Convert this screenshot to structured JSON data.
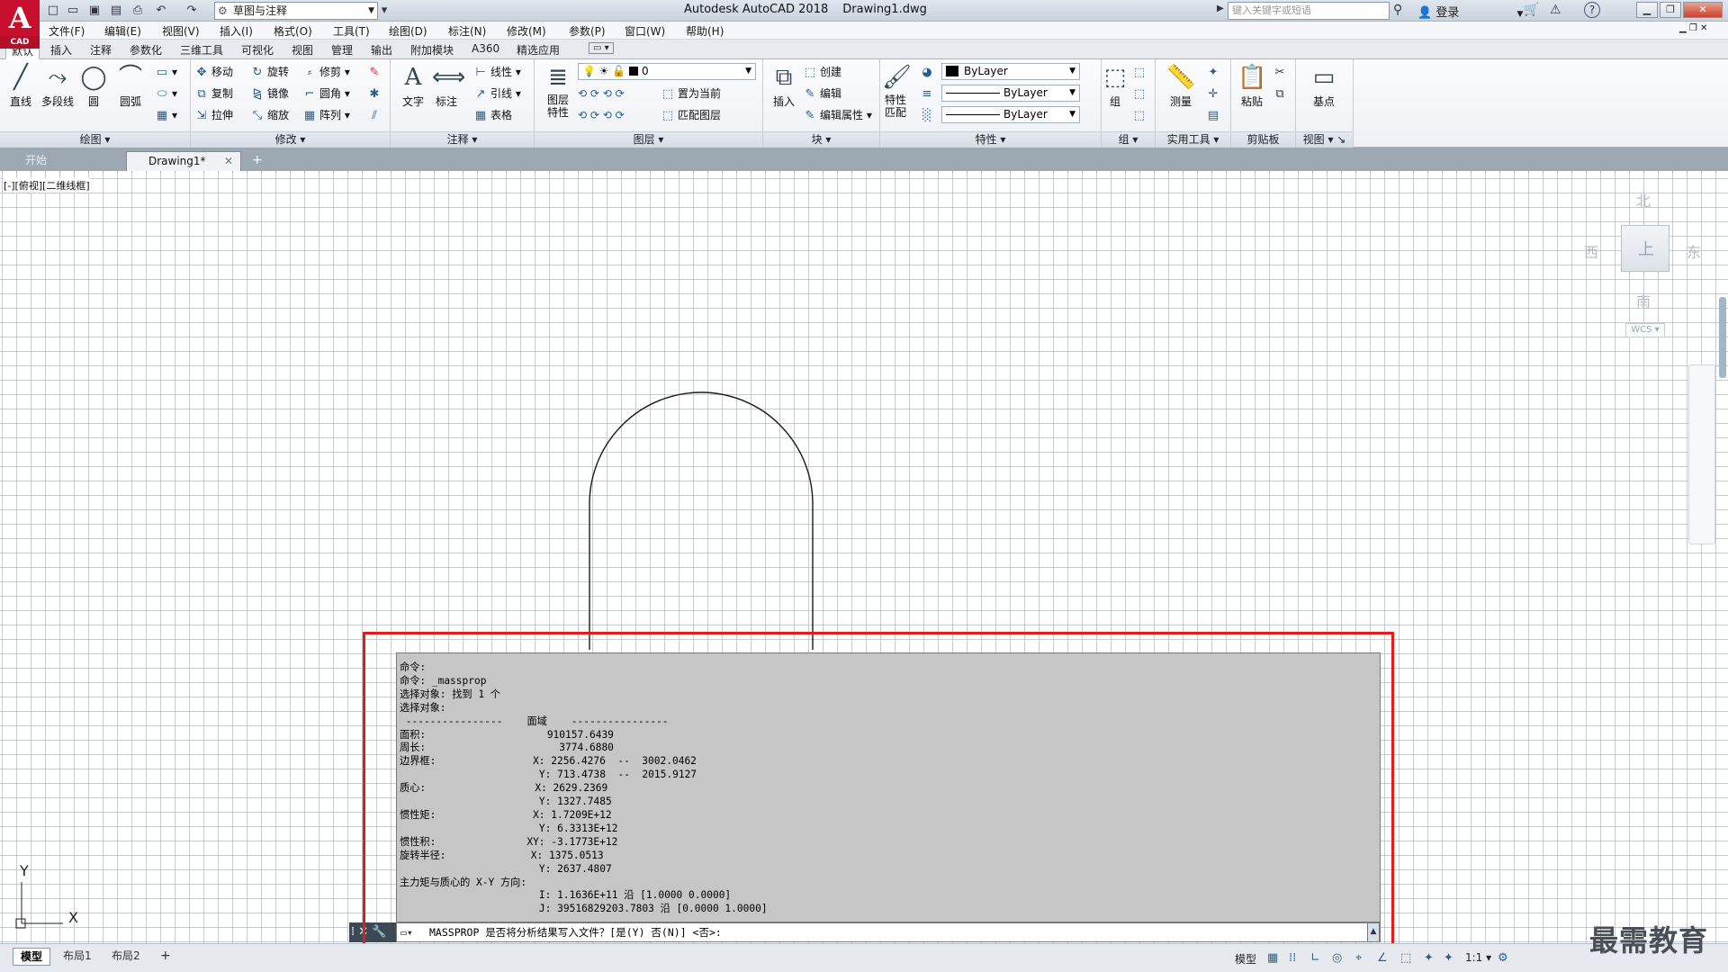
{
  "colors": {
    "accent": "#c8102e",
    "highlight": "#e01e1e",
    "canvas_grid": "#c7cbd1",
    "command_bg": "#c6c6c6"
  },
  "logo": {
    "letter": "A",
    "sub": "CAD"
  },
  "titlebar": {
    "workspace": "草图与注释",
    "app_name": "Autodesk AutoCAD 2018",
    "file": "Drawing1.dwg",
    "search_placeholder": "键入关键字或短语",
    "login": "登录"
  },
  "menu": [
    "文件(F)",
    "编辑(E)",
    "视图(V)",
    "插入(I)",
    "格式(O)",
    "工具(T)",
    "绘图(D)",
    "标注(N)",
    "修改(M)",
    "参数(P)",
    "窗口(W)",
    "帮助(H)"
  ],
  "ribbon_tabs": [
    "默认",
    "插入",
    "注释",
    "参数化",
    "三维工具",
    "可视化",
    "视图",
    "管理",
    "输出",
    "附加模块",
    "A360",
    "精选应用"
  ],
  "ribbon": {
    "draw": {
      "title": "绘图",
      "line": "直线",
      "polyline": "多段线",
      "circle": "圆",
      "arc": "圆弧"
    },
    "modify": {
      "title": "修改",
      "move": "移动",
      "rotate": "旋转",
      "trim": "修剪",
      "copy": "复制",
      "mirror": "镜像",
      "fillet": "圆角",
      "stretch": "拉伸",
      "scale": "缩放",
      "array": "阵列"
    },
    "annotation": {
      "title": "注释",
      "text": "文字",
      "dimension": "标注",
      "linear": "线性",
      "leader": "引线",
      "table": "表格"
    },
    "layers": {
      "title": "图层",
      "properties": "图层特性",
      "current_layer": "0",
      "set_current": "置为当前",
      "match": "匹配图层"
    },
    "block": {
      "title": "块",
      "insert": "插入",
      "create": "创建",
      "edit": "编辑",
      "edit_attr": "编辑属性"
    },
    "properties": {
      "title": "特性",
      "match": "特性匹配",
      "color": "ByLayer",
      "linetype": "ByLayer",
      "lineweight": "ByLayer"
    },
    "groups": {
      "title": "组",
      "group": "组"
    },
    "utilities": {
      "title": "实用工具",
      "measure": "测量"
    },
    "clipboard": {
      "title": "剪贴板",
      "paste": "粘贴"
    },
    "view": {
      "title": "视图",
      "base": "基点"
    }
  },
  "doc_tabs": {
    "start": "开始",
    "drawing": "Drawing1*"
  },
  "viewport": {
    "label": "[-][俯视][二维线框]"
  },
  "viewcube": {
    "north": "北",
    "south": "南",
    "east": "东",
    "west": "西",
    "face": "上",
    "wcs": "WCS"
  },
  "command": {
    "history": [
      "命令:",
      "命令: _massprop",
      "选择对象: 找到 1 个",
      "选择对象:",
      " ----------------    面域    ----------------",
      "面积:                    910157.6439",
      "周长:                      3774.6880",
      "边界框:                X: 2256.4276  --  3002.0462",
      "                       Y: 713.4738  --  2015.9127",
      "质心:                  X: 2629.2369",
      "                       Y: 1327.7485",
      "惯性矩:                X: 1.7209E+12",
      "                       Y: 6.3313E+12",
      "惯性积:               XY: -3.1773E+12",
      "旋转半径:              X: 1375.0513",
      "                       Y: 2637.4807",
      "主力矩与质心的 X-Y 方向:",
      "                       I: 1.1636E+11 沿 [1.0000 0.0000]",
      "                       J: 39516829203.7803 沿 [0.0000 1.0000]"
    ],
    "prompt": "MASSPROP 是否将分析结果写入文件？[是(Y) 否(N)] <否>:"
  },
  "ucs": {
    "x": "X",
    "y": "Y"
  },
  "layout_tabs": [
    "模型",
    "布局1",
    "布局2"
  ],
  "status": {
    "model": "模型",
    "scale": "1:1"
  },
  "watermark": "最需教育"
}
